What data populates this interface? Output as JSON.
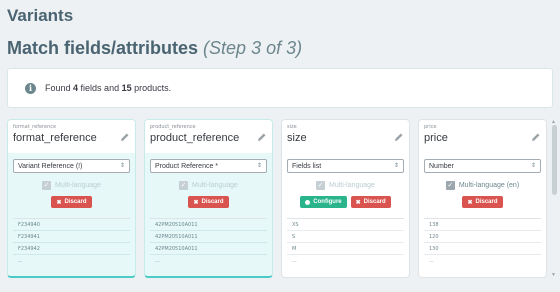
{
  "page": {
    "title": "Variants",
    "subtitle": "Match fields/attributes",
    "step": "(Step 3 of 3)"
  },
  "info": {
    "prefix": "Found ",
    "fields_count": "4",
    "middle": " fields and ",
    "products_count": "15",
    "suffix": " products."
  },
  "cards": [
    {
      "tech_name": "format_reference",
      "label": "format_reference",
      "select_value": "Variant Reference (!)",
      "multilang_label": "Multi-language",
      "discard_label": "Discard",
      "samples": [
        "F234940",
        "F234941",
        "F234942",
        "..."
      ]
    },
    {
      "tech_name": "product_reference",
      "label": "product_reference",
      "select_value": "Product Reference *",
      "multilang_label": "Multi-language",
      "discard_label": "Discard",
      "samples": [
        "42PM20510A011",
        "42PM20510A011",
        "42PM20510A011",
        "..."
      ]
    },
    {
      "tech_name": "size",
      "label": "size",
      "select_value": "Fields list",
      "multilang_label": "Multi-language",
      "configure_label": "Configure",
      "discard_label": "Discard",
      "samples": [
        "XS",
        "S",
        "M",
        "..."
      ]
    },
    {
      "tech_name": "price",
      "label": "price",
      "select_value": "Number",
      "multilang_label": "Multi-language (en)",
      "discard_label": "Discard",
      "samples": [
        "138",
        "120",
        "130",
        "..."
      ]
    }
  ]
}
